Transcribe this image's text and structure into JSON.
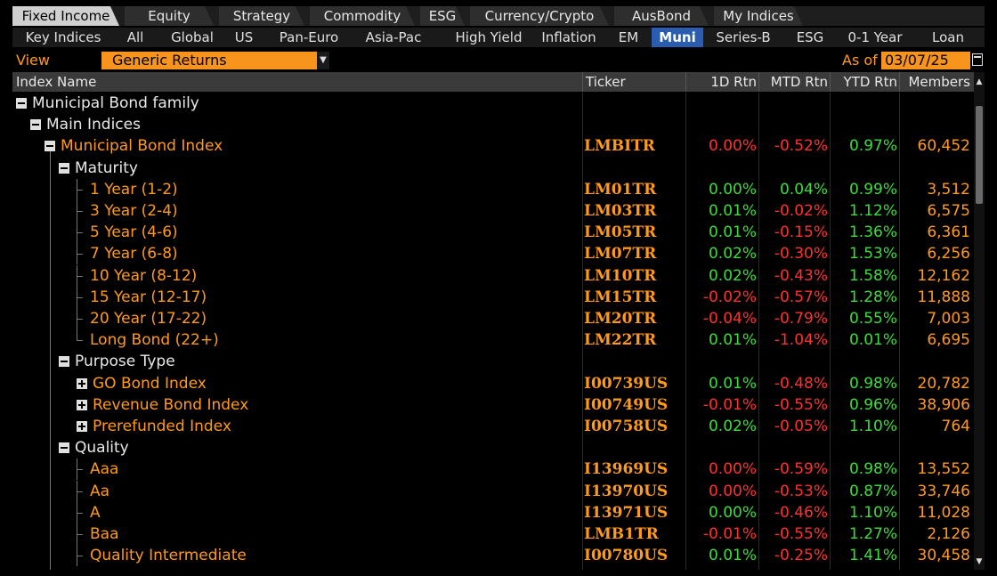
{
  "tabs": [
    {
      "label": "Fixed Income",
      "active": true
    },
    {
      "label": "Equity"
    },
    {
      "label": "Strategy"
    },
    {
      "label": "Commodity"
    },
    {
      "label": "ESG"
    },
    {
      "label": "Currency/Crypto"
    },
    {
      "label": "AusBond"
    },
    {
      "label": "My Indices"
    }
  ],
  "subtabs": [
    {
      "label": "Key Indices"
    },
    {
      "label": "All"
    },
    {
      "label": "Global"
    },
    {
      "label": "US"
    },
    {
      "label": "Pan-Euro"
    },
    {
      "label": "Asia-Pac"
    },
    {
      "label": "High Yield"
    },
    {
      "label": "Inflation"
    },
    {
      "label": "EM"
    },
    {
      "label": "Muni",
      "active": true
    },
    {
      "label": "Series-B"
    },
    {
      "label": "ESG"
    },
    {
      "label": "0-1 Year"
    },
    {
      "label": "Loan"
    }
  ],
  "view": {
    "label": "View",
    "selected": "Generic Returns"
  },
  "asof": {
    "label": "As of",
    "date": "03/07/25"
  },
  "columns": {
    "name": "Index Name",
    "ticker": "Ticker",
    "d1": "1D Rtn",
    "mtd": "MTD Rtn",
    "ytd": "YTD Rtn",
    "members": "Members"
  },
  "colors": {
    "accent": "#ff9a1a",
    "positive": "#3ddc3d",
    "negative": "#ff3030",
    "active_tab": "#2a5db0"
  },
  "rows": [
    {
      "name": "Municipal Bond family",
      "level": 0,
      "type": "group",
      "expander": "minus"
    },
    {
      "name": "Main Indices",
      "level": 1,
      "type": "group",
      "expander": "minus"
    },
    {
      "name": "Municipal Bond Index",
      "level": 2,
      "type": "index",
      "expander": "minus",
      "ticker": "LMBITR",
      "d1": "0.00%",
      "mtd": "-0.52%",
      "ytd": "0.97%",
      "members": "60,452",
      "d1c": "neg",
      "mtdc": "neg",
      "ytdc": "pos"
    },
    {
      "name": "Maturity",
      "level": 3,
      "type": "group",
      "expander": "minus"
    },
    {
      "name": "1 Year (1-2)",
      "level": 4,
      "type": "leaf",
      "ticker": "LM01TR",
      "d1": "0.00%",
      "mtd": "0.04%",
      "ytd": "0.99%",
      "members": "3,512",
      "d1c": "pos",
      "mtdc": "pos",
      "ytdc": "pos"
    },
    {
      "name": "3 Year (2-4)",
      "level": 4,
      "type": "leaf",
      "ticker": "LM03TR",
      "d1": "0.01%",
      "mtd": "-0.02%",
      "ytd": "1.12%",
      "members": "6,575",
      "d1c": "pos",
      "mtdc": "neg",
      "ytdc": "pos"
    },
    {
      "name": "5 Year (4-6)",
      "level": 4,
      "type": "leaf",
      "ticker": "LM05TR",
      "d1": "0.01%",
      "mtd": "-0.15%",
      "ytd": "1.36%",
      "members": "6,361",
      "d1c": "pos",
      "mtdc": "neg",
      "ytdc": "pos"
    },
    {
      "name": "7 Year (6-8)",
      "level": 4,
      "type": "leaf",
      "ticker": "LM07TR",
      "d1": "0.02%",
      "mtd": "-0.30%",
      "ytd": "1.53%",
      "members": "6,256",
      "d1c": "pos",
      "mtdc": "neg",
      "ytdc": "pos"
    },
    {
      "name": "10 Year (8-12)",
      "level": 4,
      "type": "leaf",
      "ticker": "LM10TR",
      "d1": "0.02%",
      "mtd": "-0.43%",
      "ytd": "1.58%",
      "members": "12,162",
      "d1c": "pos",
      "mtdc": "neg",
      "ytdc": "pos"
    },
    {
      "name": "15 Year (12-17)",
      "level": 4,
      "type": "leaf",
      "ticker": "LM15TR",
      "d1": "-0.02%",
      "mtd": "-0.57%",
      "ytd": "1.28%",
      "members": "11,888",
      "d1c": "neg",
      "mtdc": "neg",
      "ytdc": "pos"
    },
    {
      "name": "20 Year (17-22)",
      "level": 4,
      "type": "leaf",
      "ticker": "LM20TR",
      "d1": "-0.04%",
      "mtd": "-0.79%",
      "ytd": "0.55%",
      "members": "7,003",
      "d1c": "neg",
      "mtdc": "neg",
      "ytdc": "pos"
    },
    {
      "name": "Long Bond (22+)",
      "level": 4,
      "type": "leaf",
      "last": true,
      "ticker": "LM22TR",
      "d1": "0.01%",
      "mtd": "-1.04%",
      "ytd": "0.01%",
      "members": "6,695",
      "d1c": "pos",
      "mtdc": "neg",
      "ytdc": "pos"
    },
    {
      "name": "Purpose Type",
      "level": 3,
      "type": "group",
      "expander": "minus"
    },
    {
      "name": "GO Bond Index",
      "level": 4,
      "type": "index",
      "expander": "plus",
      "ticker": "I00739US",
      "d1": "0.01%",
      "mtd": "-0.48%",
      "ytd": "0.98%",
      "members": "20,782",
      "d1c": "pos",
      "mtdc": "neg",
      "ytdc": "pos"
    },
    {
      "name": "Revenue Bond Index",
      "level": 4,
      "type": "index",
      "expander": "plus",
      "ticker": "I00749US",
      "d1": "-0.01%",
      "mtd": "-0.55%",
      "ytd": "0.96%",
      "members": "38,906",
      "d1c": "neg",
      "mtdc": "neg",
      "ytdc": "pos"
    },
    {
      "name": "Prerefunded Index",
      "level": 4,
      "type": "index",
      "expander": "plus",
      "ticker": "I00758US",
      "d1": "0.02%",
      "mtd": "-0.05%",
      "ytd": "1.10%",
      "members": "764",
      "d1c": "pos",
      "mtdc": "neg",
      "ytdc": "pos"
    },
    {
      "name": "Quality",
      "level": 3,
      "type": "group",
      "expander": "minus"
    },
    {
      "name": "Aaa",
      "level": 4,
      "type": "leaf",
      "ticker": "I13969US",
      "d1": "0.00%",
      "mtd": "-0.59%",
      "ytd": "0.98%",
      "members": "13,552",
      "d1c": "neg",
      "mtdc": "neg",
      "ytdc": "pos"
    },
    {
      "name": "Aa",
      "level": 4,
      "type": "leaf",
      "ticker": "I13970US",
      "d1": "0.00%",
      "mtd": "-0.53%",
      "ytd": "0.87%",
      "members": "33,746",
      "d1c": "neg",
      "mtdc": "neg",
      "ytdc": "pos"
    },
    {
      "name": "A",
      "level": 4,
      "type": "leaf",
      "ticker": "I13971US",
      "d1": "0.00%",
      "mtd": "-0.46%",
      "ytd": "1.10%",
      "members": "11,028",
      "d1c": "pos",
      "mtdc": "neg",
      "ytdc": "pos"
    },
    {
      "name": "Baa",
      "level": 4,
      "type": "leaf",
      "ticker": "LMB1TR",
      "d1": "-0.01%",
      "mtd": "-0.55%",
      "ytd": "1.27%",
      "members": "2,126",
      "d1c": "neg",
      "mtdc": "neg",
      "ytdc": "pos"
    },
    {
      "name": "Quality Intermediate",
      "level": 4,
      "type": "leaf",
      "ticker": "I00780US",
      "d1": "0.01%",
      "mtd": "-0.25%",
      "ytd": "1.41%",
      "members": "30,458",
      "d1c": "pos",
      "mtdc": "neg",
      "ytdc": "pos"
    }
  ]
}
